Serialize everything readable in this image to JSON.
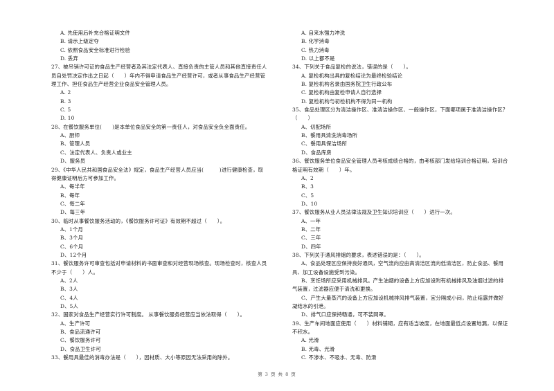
{
  "page": {
    "footer": "第 3 页 共 8 页"
  },
  "left_column": [
    {
      "type": "opt",
      "text": "A. 先使用后补充合格证明文件"
    },
    {
      "type": "opt",
      "text": "B. 请示上级定夺"
    },
    {
      "type": "opt",
      "text": "C. 依照食品安全标准进行检验"
    },
    {
      "type": "opt",
      "text": "D. 丢弃"
    },
    {
      "type": "q",
      "text": "27、被吊销许可证的食品生产经营者及其法定代表人、直接负责的主管人员和其他直接责任人"
    },
    {
      "type": "q-cont",
      "text": "员自处罚决定作出之日起（　　）年内不得申请食品生产经营许可，或者从事食品生产经营管"
    },
    {
      "type": "q-cont",
      "text": "理工作、担任食品生产经营企业食品安全管理人员。"
    },
    {
      "type": "opt",
      "text": "A. 2"
    },
    {
      "type": "opt",
      "text": "B. 3"
    },
    {
      "type": "opt",
      "text": "C. 5"
    },
    {
      "type": "opt",
      "text": "D. 10"
    },
    {
      "type": "q",
      "text": "28、在餐饮服务单位(　　)是本单位食品安全的第一责任人，对食品安全负全面责任。"
    },
    {
      "type": "opt",
      "text": "A、厨师"
    },
    {
      "type": "opt",
      "text": "B、管理人员"
    },
    {
      "type": "opt",
      "text": "C、法定代表人、负责人或业主"
    },
    {
      "type": "opt",
      "text": "D、服务员"
    },
    {
      "type": "q",
      "text": "29、《中华人民共和国食品安全法》规定，食品生产经营人员应当(　　　)进行健康检查，取"
    },
    {
      "type": "q-cont",
      "text": "得健康证明后方可参加工作。"
    },
    {
      "type": "opt",
      "text": "A、每半年"
    },
    {
      "type": "opt",
      "text": "B、每年"
    },
    {
      "type": "opt",
      "text": "C、每二年"
    },
    {
      "type": "opt",
      "text": "D、每三年"
    },
    {
      "type": "q",
      "text": "30、临时从事餐饮服务活动的，《餐饮服务许可证》有效期不超过（　　）。"
    },
    {
      "type": "opt",
      "text": "A、1个月"
    },
    {
      "type": "opt",
      "text": "B、3个月"
    },
    {
      "type": "opt",
      "text": "C、6个月"
    },
    {
      "type": "opt",
      "text": "D、12个月"
    },
    {
      "type": "q",
      "text": "31、餐饮服务许可审查包括对申请材料的书面审查和对经营现场核查。现场检查时，核查人员"
    },
    {
      "type": "q-cont",
      "text": "不少于（　　）人。"
    },
    {
      "type": "opt",
      "text": "A、2人"
    },
    {
      "type": "opt",
      "text": "B、3人"
    },
    {
      "type": "opt",
      "text": "C、4人"
    },
    {
      "type": "opt",
      "text": "D、5人"
    },
    {
      "type": "q",
      "text": "32、国家对食品生产经营实行许可制度。 从事餐饮服务经营应当依法取得（　　）。"
    },
    {
      "type": "opt",
      "text": "A、生产许可"
    },
    {
      "type": "opt",
      "text": "B、食品流通许可"
    },
    {
      "type": "opt",
      "text": "C、餐饮服务许可"
    },
    {
      "type": "opt",
      "text": "D、食品卫生许可"
    },
    {
      "type": "q",
      "text": "33、餐用具最佳的消毒办法是（　　），因材质、大小等原因无法采用的除外。"
    }
  ],
  "right_column": [
    {
      "type": "opt",
      "text": "A. 自来水强力冲洗"
    },
    {
      "type": "opt",
      "text": "B. 化学消毒"
    },
    {
      "type": "opt",
      "text": "C. 热力消毒"
    },
    {
      "type": "opt",
      "text": "D. 以上都不是"
    },
    {
      "type": "q",
      "text": "34、下列关于食品复检的说法，错误的是（　　）。"
    },
    {
      "type": "opt",
      "text": "A. 复检机构出具的复检结论为最终检验结论"
    },
    {
      "type": "opt",
      "text": "B. 复检机构名录由国务院卫生行政公布"
    },
    {
      "type": "opt",
      "text": "C. 复检机构由复检申请人自行选择"
    },
    {
      "type": "opt",
      "text": "D. 复检机构与初检机构不得为同一机构"
    },
    {
      "type": "q",
      "text": "35、食品处理区分为清洁操作区、准清洁操作区、一般操作区，下面哪项属于准清洁操作区？"
    },
    {
      "type": "q-cont",
      "text": "（　　）"
    },
    {
      "type": "opt",
      "text": "A、切配场所"
    },
    {
      "type": "opt",
      "text": "B、餐用具清洗消毒场所"
    },
    {
      "type": "opt",
      "text": "C、餐用具保洁场所"
    },
    {
      "type": "opt",
      "text": "D、食品库房"
    },
    {
      "type": "q",
      "text": "36、餐饮服务单位食品安全管理人员考核成绩合格的，由考核部门发给培训合格证明，培训合"
    },
    {
      "type": "q-cont",
      "text": "格证明有效期（　　）年。"
    },
    {
      "type": "opt",
      "text": "A、2"
    },
    {
      "type": "opt",
      "text": "B、3"
    },
    {
      "type": "opt",
      "text": "C、5"
    },
    {
      "type": "opt",
      "text": "D、10"
    },
    {
      "type": "q",
      "text": "37、餐饮服务从业人员法律法规及卫生知识培训应（　　）进行一次。"
    },
    {
      "type": "opt",
      "text": "A、一年"
    },
    {
      "type": "opt",
      "text": "B、二年"
    },
    {
      "type": "opt",
      "text": "C、三年"
    },
    {
      "type": "opt",
      "text": "D、四年"
    },
    {
      "type": "q",
      "text": "38、下列关于通风排烟的要求，表述错误的是：（　　）。"
    },
    {
      "type": "opt",
      "text": "A、食品处理区应保持良好通风，空气流向应由高清洁区流向低清洁区，防止食品、餐用"
    },
    {
      "type": "opt-cont",
      "text": "具、加工设备设施受到污染。"
    },
    {
      "type": "opt",
      "text": "B、烹饪场所应采用机械排风。产生油烟的设备上方应加设附有机械排风及油烟过滤的排"
    },
    {
      "type": "opt-cont",
      "text": "气装置，过滤器应便于清洗和更换。"
    },
    {
      "type": "opt",
      "text": "C、产生大量蒸汽的设备上方应加设机械排风排气装置，宜分隔成小间，防止结露并做好"
    },
    {
      "type": "opt-cont",
      "text": "凝结水的引泄。"
    },
    {
      "type": "opt",
      "text": "D、排气口应保持畅通，可不装网罩。"
    },
    {
      "type": "q",
      "text": "39、生产车间地面应使用（　　）材料铺砌，应有适当坡度，在地面最低点设置地漏，以保证"
    },
    {
      "type": "q-cont",
      "text": "不积水。"
    },
    {
      "type": "opt",
      "text": "A. 光滑"
    },
    {
      "type": "opt",
      "text": "B. 无毒、光滑"
    },
    {
      "type": "opt",
      "text": "C. 不渗水、不吸水、无毒、防滑"
    }
  ]
}
